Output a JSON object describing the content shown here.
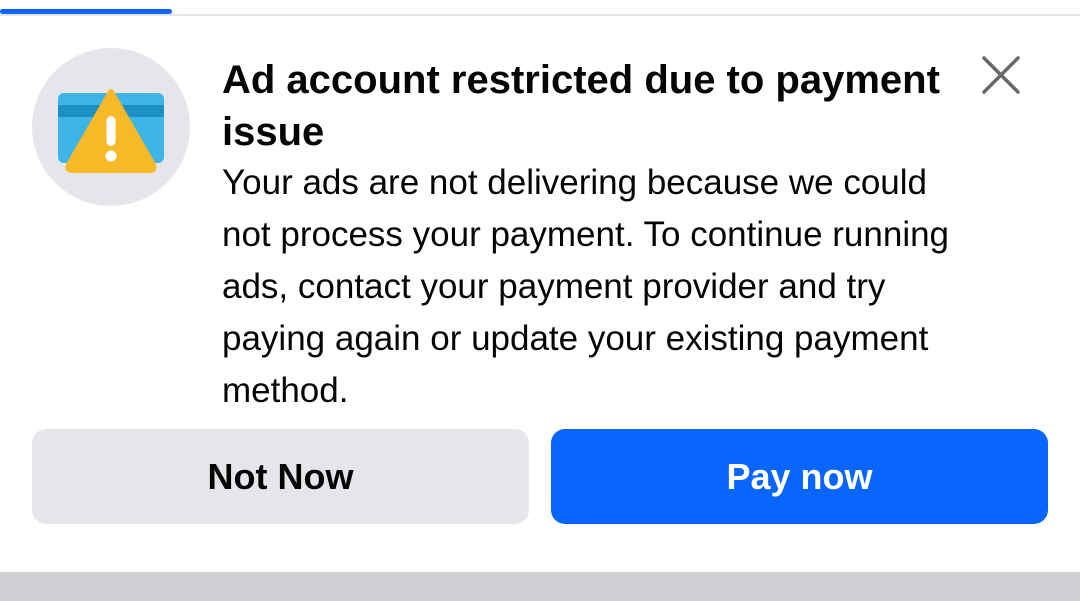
{
  "dialog": {
    "title": "Ad account restricted due to payment issue",
    "message": "Your ads are not delivering because we could not process your payment. To continue running ads, contact your payment provider and try paying again or update your existing payment method.",
    "icon": "credit-card-warning-icon",
    "close_icon": "close-icon",
    "secondary_button_label": "Not Now",
    "primary_button_label": "Pay now"
  },
  "colors": {
    "accent": "#0866ff",
    "card_blue": "#3db5e6",
    "card_stripe": "#1c8fc4",
    "warning_yellow": "#f7b928"
  }
}
